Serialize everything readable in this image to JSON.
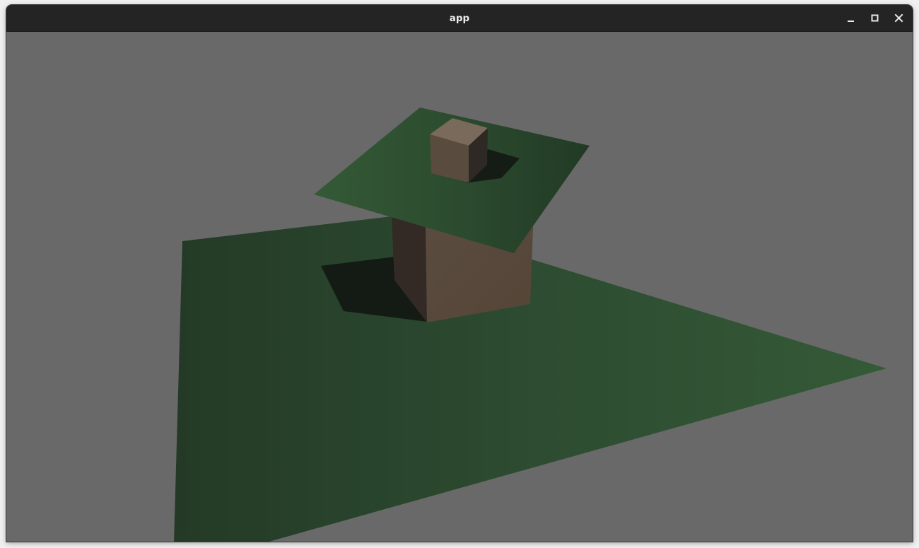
{
  "window": {
    "title": "app"
  },
  "titlebar_controls": [
    "minimize-icon",
    "maximize-icon",
    "close-icon"
  ],
  "scene": {
    "background_color": "#696969",
    "ground_color": "#2f5233",
    "platform_color": "#2f5233",
    "cube_color": "#5a4a3e",
    "shadow_color": "#141a14"
  }
}
